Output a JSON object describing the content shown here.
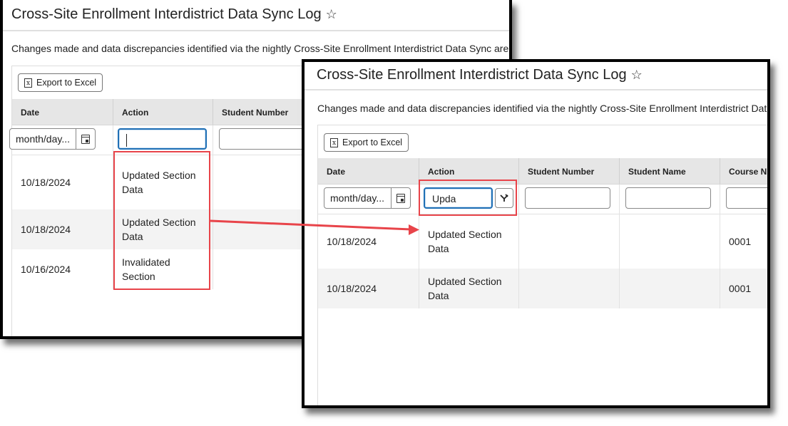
{
  "back_panel": {
    "title": "Cross-Site Enrollment Interdistrict Data Sync Log",
    "favorite_icon": "star-outline-icon",
    "description": "Changes made and data discrepancies identified via the nightly Cross-Site Enrollment Interdistrict Data Sync are",
    "export_label": "Export to Excel",
    "columns": [
      "Date",
      "Action",
      "Student Number"
    ],
    "filters": {
      "date_placeholder": "month/day...",
      "action_value": ""
    },
    "rows": [
      {
        "date": "10/18/2024",
        "action": "Updated Section Data"
      },
      {
        "date": "10/18/2024",
        "action": "Updated Section Data"
      },
      {
        "date": "10/16/2024",
        "action": "Invalidated Section"
      }
    ]
  },
  "front_panel": {
    "title": "Cross-Site Enrollment Interdistrict Data Sync Log",
    "favorite_icon": "star-outline-icon",
    "description": "Changes made and data discrepancies identified via the nightly Cross-Site Enrollment Interdistrict Data",
    "export_label": "Export to Excel",
    "columns": [
      "Date",
      "Action",
      "Student Number",
      "Student Name",
      "Course Nu"
    ],
    "filters": {
      "date_placeholder": "month/day...",
      "action_value": "Upda"
    },
    "rows": [
      {
        "date": "10/18/2024",
        "action": "Updated Section Data",
        "student_number": "",
        "student_name": "",
        "course_number": "0001"
      },
      {
        "date": "10/18/2024",
        "action": "Updated Section Data",
        "student_number": "",
        "student_name": "",
        "course_number": "0001"
      }
    ]
  },
  "annotation": {
    "highlight_color": "#e8444a",
    "focus_color": "#1f6fb5"
  }
}
